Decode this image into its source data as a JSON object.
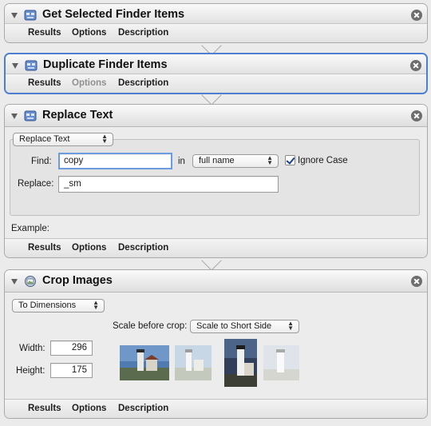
{
  "actions": [
    {
      "title": "Get Selected Finder Items",
      "footer": [
        "Results",
        "Options",
        "Description"
      ]
    },
    {
      "title": "Duplicate Finder Items",
      "footer": [
        "Results",
        "Options",
        "Description"
      ]
    },
    {
      "title": "Replace Text",
      "popup": "Replace Text",
      "find_label": "Find:",
      "find_value": "copy",
      "in_label": "in",
      "in_select": "full name",
      "ignore_case_label": "Ignore Case",
      "replace_label": "Replace:",
      "replace_value": "_sm",
      "example_label": "Example:",
      "footer": [
        "Results",
        "Options",
        "Description"
      ]
    },
    {
      "title": "Crop Images",
      "popup": "To Dimensions",
      "scale_label": "Scale before crop:",
      "scale_select": "Scale to Short Side",
      "width_label": "Width:",
      "width_value": "296",
      "height_label": "Height:",
      "height_value": "175",
      "footer": [
        "Results",
        "Options",
        "Description"
      ]
    }
  ],
  "colors": {
    "selected_border": "#4d7fd1",
    "focus_ring": "#6d9be0",
    "disabled_text": "#8f8f8f"
  },
  "icons": [
    "disclosure-triangle-icon",
    "finder-action-icon",
    "preview-action-icon",
    "close-icon",
    "checkmark-icon"
  ]
}
